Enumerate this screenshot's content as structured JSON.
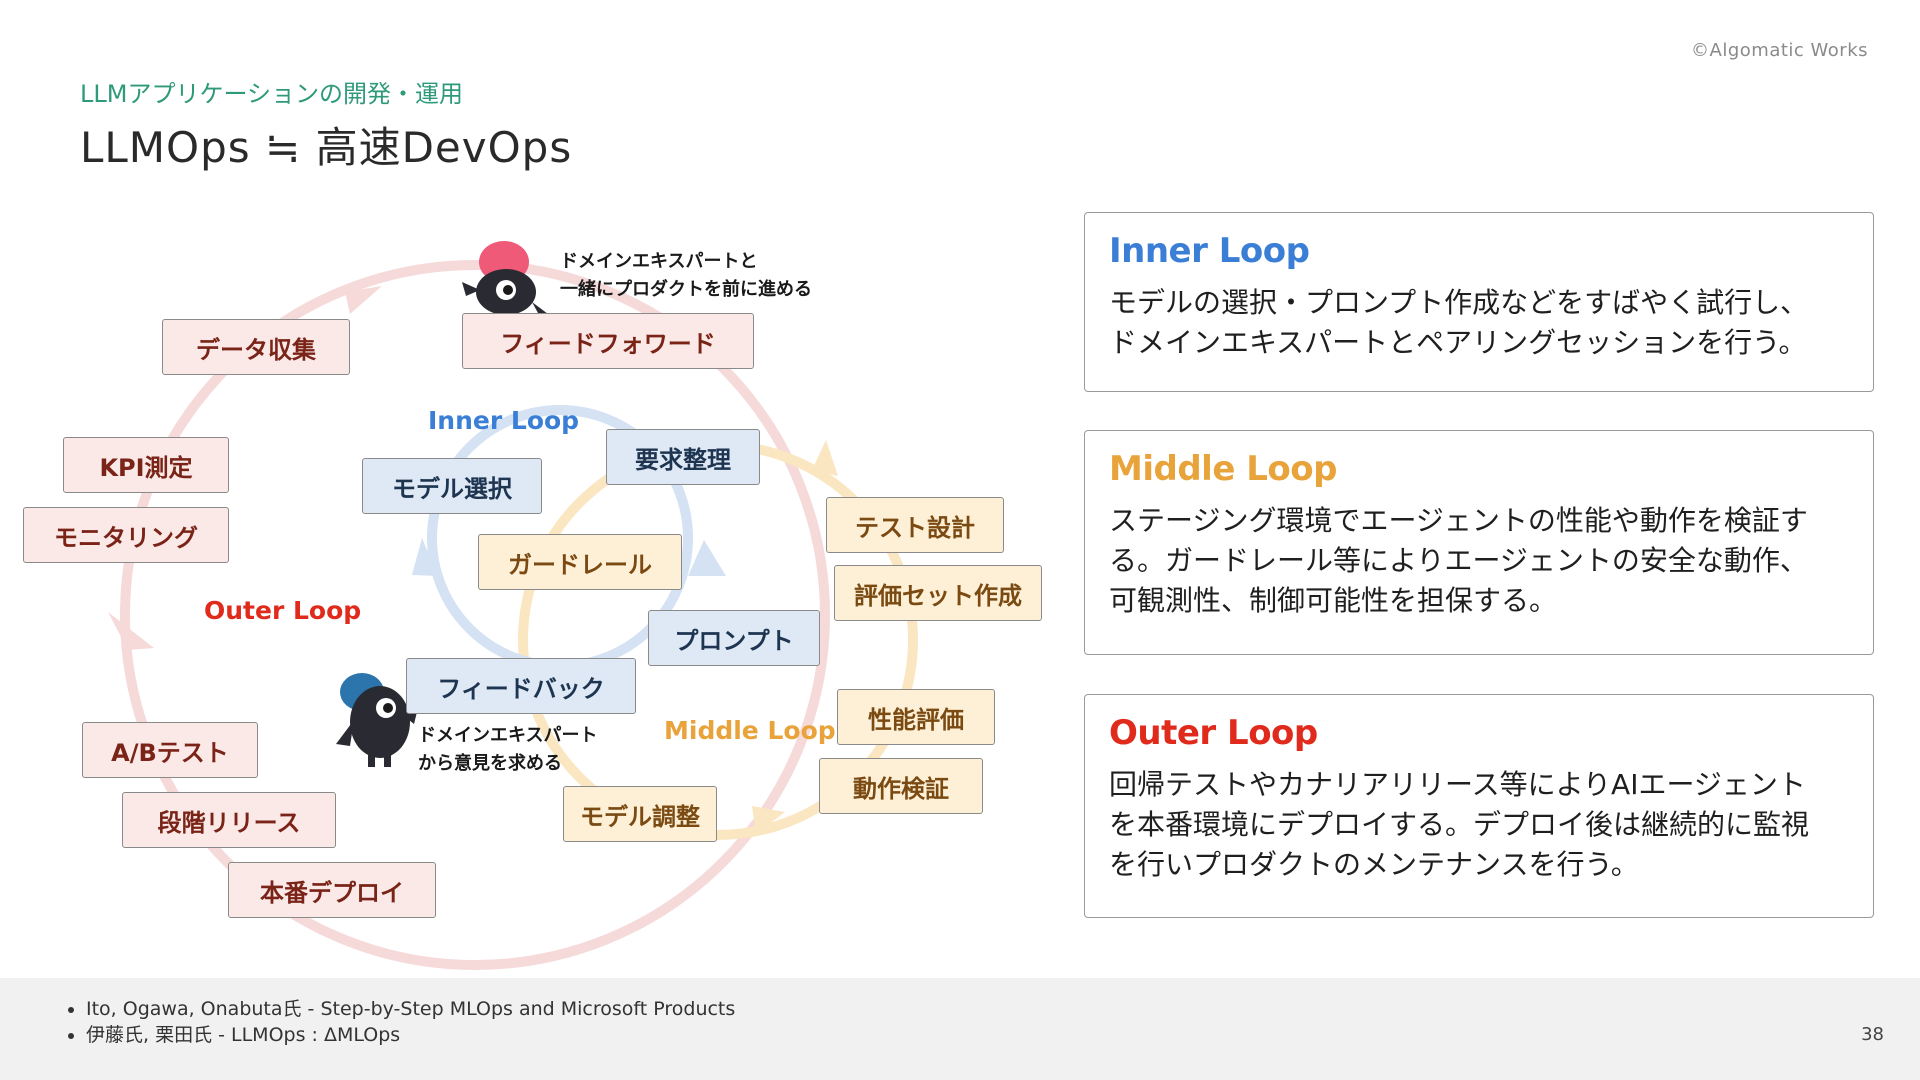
{
  "header": {
    "copyright": "©Algomatic Works",
    "subtitle": "LLMアプリケーションの開発・運用",
    "title": "LLMOps ≒ 高速DevOps"
  },
  "diagram": {
    "outer_label": "Outer Loop",
    "middle_label": "Middle Loop",
    "inner_label": "Inner Loop",
    "outer_items": [
      "データ収集",
      "KPI測定",
      "モニタリング",
      "A/Bテスト",
      "段階リリース",
      "本番デプロイ"
    ],
    "feedforward": "フィードフォワード",
    "middle_items": [
      "テスト設計",
      "評価セット作成",
      "性能評価",
      "動作検証",
      "モデル調整"
    ],
    "inner_items": [
      "要求整理",
      "モデル選択",
      "ガードレール",
      "プロンプト",
      "フィードバック"
    ],
    "mascot_top_text": [
      "ドメインエキスパートと",
      "一緒にプロダクトを前に進める"
    ],
    "mascot_bottom_text": [
      "ドメインエキスパート",
      "から意見を求める"
    ],
    "colors": {
      "outer": "#e02a1c",
      "middle": "#e8a33a",
      "inner": "#3a7fd5",
      "outer_ring": "#f6dada",
      "middle_ring": "#fbe6c2",
      "inner_ring": "#d4e2f4",
      "mascot_top_head": "#ee5a78",
      "mascot_bottom_head": "#2b74ac",
      "mascot_body": "#2a2a33"
    }
  },
  "cards": [
    {
      "title": "Inner Loop",
      "color": "#3a7fd5",
      "lines": [
        "モデルの選択・プロンプト作成などをすばやく試行し、",
        "ドメインエキスパートとペアリングセッションを行う。"
      ]
    },
    {
      "title": "Middle Loop",
      "color": "#e8a33a",
      "lines": [
        "ステージング環境でエージェントの性能や動作を検証す",
        "る。ガードレール等によりエージェントの安全な動作、",
        "可観測性、制御可能性を担保する。"
      ]
    },
    {
      "title": "Outer Loop",
      "color": "#e02a1c",
      "lines": [
        "回帰テストやカナリアリリース等によりAIエージェント",
        "を本番環境にデプロイする。デプロイ後は継続的に監視",
        "を行いプロダクトのメンテナンスを行う。"
      ]
    }
  ],
  "footer": {
    "references": [
      "Ito, Ogawa, Onabuta氏 - Step-by-Step MLOps and Microsoft Products",
      "伊藤氏, 栗田氏 - LLMOps : ΔMLOps"
    ],
    "page": "38"
  }
}
